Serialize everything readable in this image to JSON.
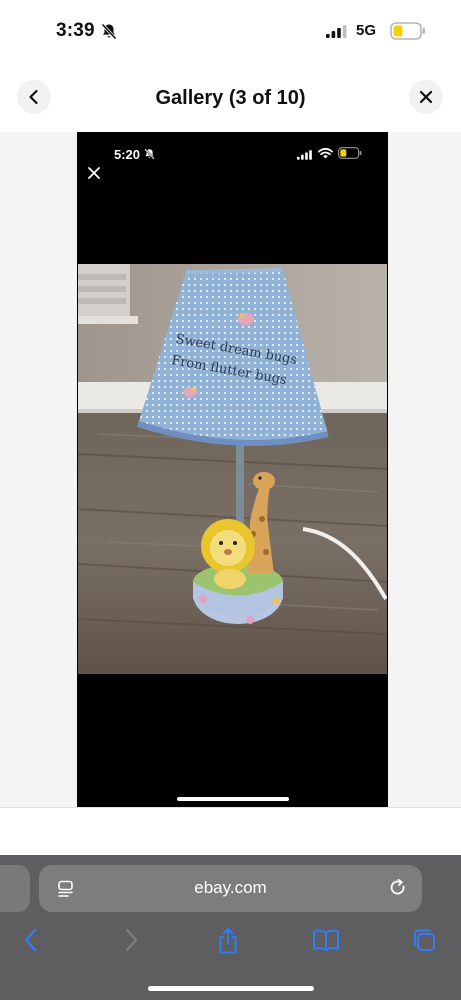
{
  "status_bar": {
    "time": "3:39",
    "network": "5G",
    "icons": [
      "bell-slash-icon",
      "cellular-signal-icon",
      "battery-low-icon"
    ]
  },
  "header": {
    "title": "Gallery (3 of 10)",
    "back_icon": "chevron-left-icon",
    "close_icon": "close-icon"
  },
  "gallery": {
    "image_screen": {
      "time": "5:20",
      "icons": [
        "bell-slash-icon",
        "cellular-signal-icon",
        "wifi-icon",
        "battery-low-icon",
        "close-icon"
      ]
    },
    "photo": {
      "shade_text_line1": "Sweet dream bugs",
      "shade_text_line2": "From flutter bugs"
    }
  },
  "browser": {
    "url": "ebay.com",
    "icons": [
      "reader-mode-icon",
      "reload-icon",
      "back-arrow-icon",
      "forward-arrow-icon",
      "share-icon",
      "bookmarks-icon",
      "tabs-icon"
    ]
  },
  "colors": {
    "toolbar": "#5e5e60",
    "url_field": "#7d7d80",
    "accent_blue": "#2f7cf6",
    "battery_yellow": "#f5d00a"
  }
}
